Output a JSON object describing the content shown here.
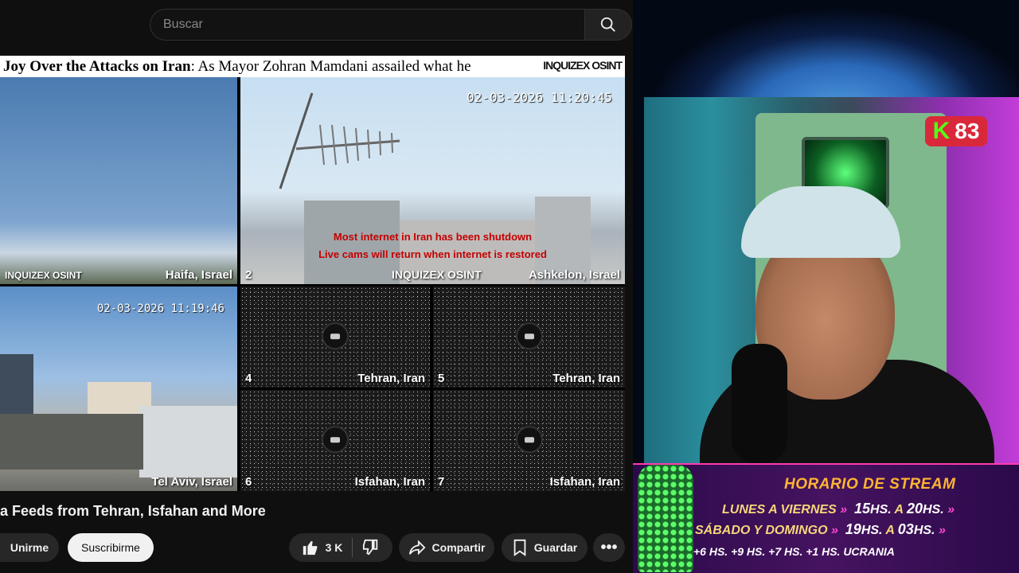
{
  "search": {
    "placeholder": "Buscar"
  },
  "ticker": {
    "bold_text": "Joy Over the Attacks on Iran",
    "rest_text": ": As Mayor Zohran Mamdani assailed what he",
    "logo": "INQUIZEX OSINT"
  },
  "cameras": {
    "haifa": {
      "location": "Haifa, Israel",
      "watermark": "INQUIZEX OSINT"
    },
    "ashkelon": {
      "number": "2",
      "location": "Ashkelon, Israel",
      "timestamp": "02-03-2026 11:20:45",
      "watermark": "INQUIZEX OSINT"
    },
    "telaviv": {
      "number": "",
      "location": "Tel Aviv, Israel",
      "timestamp": "02-03-2026 11:19:46"
    },
    "tehran4": {
      "number": "4",
      "location": "Tehran, Iran"
    },
    "tehran5": {
      "number": "5",
      "location": "Tehran, Iran"
    },
    "isfahan6": {
      "number": "6",
      "location": "Isfahan, Iran"
    },
    "isfahan7": {
      "number": "7",
      "location": "Isfahan, Iran"
    },
    "iran_message_line1": "Most internet in Iran has been shutdown",
    "iran_message_line2": "Live cams will return when internet is restored"
  },
  "video": {
    "title": "a Feeds from Tehran, Isfahan and More",
    "join_label": "Unirme",
    "subscribe_label": "Suscribirme",
    "likes": "3 K",
    "share_label": "Compartir",
    "save_label": "Guardar",
    "more_label": "•••"
  },
  "overlay": {
    "kick_count": "83",
    "kick_letter": "K",
    "schedule_title": "HORARIO DE STREAM",
    "line1_days": "LUNES A VIERNES",
    "line1_from": "15",
    "line1_to": "20",
    "line2_days": "SÁBADO Y DOMINGO",
    "line2_from": "19",
    "line2_to": "03",
    "hs": "HS.",
    "a": "A",
    "timezones": "+6 HS.   +9 HS.   +7 HS.   +1 HS. UCRANIA"
  }
}
